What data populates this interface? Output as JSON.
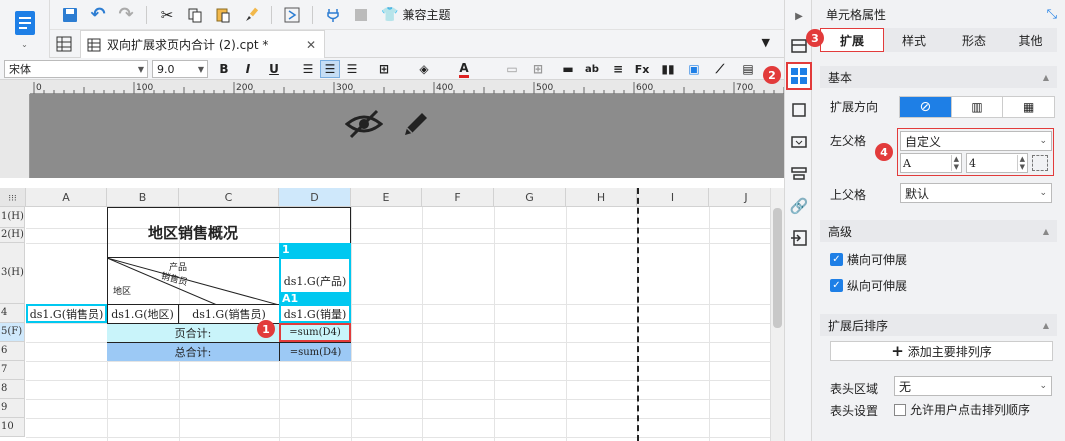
{
  "toolbar": {
    "theme_button_label": "兼容主题"
  },
  "tab": {
    "title": "双向扩展求页内合计 (2).cpt *"
  },
  "format": {
    "font_name": "宋体",
    "font_size": "9.0"
  },
  "ruler_ticks": [
    "0",
    "100",
    "200",
    "300",
    "400",
    "500",
    "600",
    "700"
  ],
  "columns": [
    "A",
    "B",
    "C",
    "D",
    "E",
    "F",
    "G",
    "H",
    "I",
    "J"
  ],
  "rows": [
    "1(H)",
    "2(H)",
    "3(H)",
    "4",
    "5(F)",
    "6",
    "7",
    "8",
    "9",
    "10"
  ],
  "report": {
    "title": "地区销售概况",
    "diag_product": "产品",
    "diag_salesman": "销售员",
    "diag_region": "地区",
    "d1_tag": "1",
    "d3_value": "ds1.G(产品)",
    "a1_tag": "A1",
    "a4_value": "ds1.G(销售员)",
    "b4_value": "ds1.G(地区)",
    "c4_value": "ds1.G(销售员)",
    "d4_value": "ds1.G(销量)",
    "page_total_label": "页合计:",
    "page_total_formula": "=sum(D4)",
    "grand_total_label": "总合计:",
    "grand_total_formula": "=sum(D4)"
  },
  "badges": [
    "1",
    "2",
    "3",
    "4"
  ],
  "panel": {
    "title": "单元格属性",
    "tabs": [
      "扩展",
      "样式",
      "形态",
      "其他"
    ],
    "basic": "基本",
    "expand_direction": "扩展方向",
    "left_parent": "左父格",
    "left_parent_value": "自定义",
    "left_col_value": "A",
    "left_row_value": "4",
    "top_parent": "上父格",
    "top_parent_value": "默认",
    "advanced": "高级",
    "horizontal_expand": "横向可伸展",
    "vertical_expand": "纵向可伸展",
    "sort_after_expand": "扩展后排序",
    "add_sort_button": "添加主要排列序",
    "header_area": "表头区域",
    "header_area_value": "无",
    "header_settings": "表头设置",
    "allow_click_sort": "允许用户点击排列顺序"
  },
  "colors": {
    "accent": "#1e7fe6",
    "cyan": "#00c8f0",
    "light_cyan": "#c9f4fa",
    "blue_row": "#9cc9f5",
    "red": "#e23b3b"
  }
}
